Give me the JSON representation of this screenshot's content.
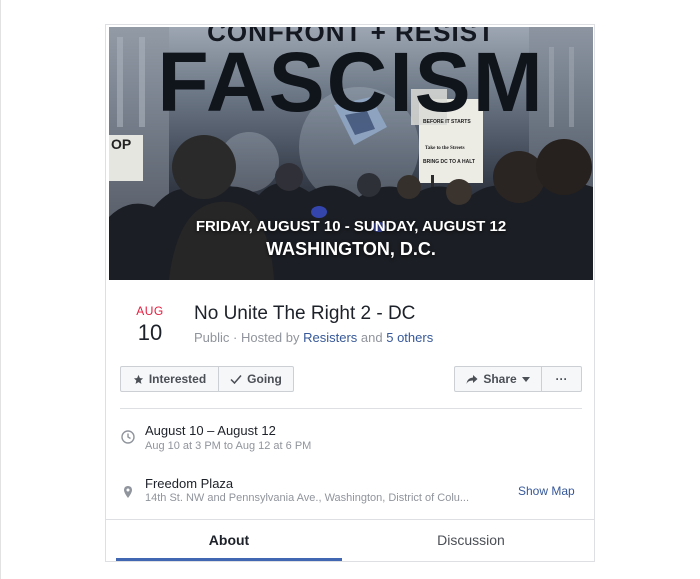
{
  "cover": {
    "headline_top": "CONFRONT + RESIST",
    "headline_main": "FASCISM",
    "dates": "FRIDAY, AUGUST 10 - SUNDAY, AUGUST 12",
    "city": "WASHINGTON, D.C.",
    "sign_left": "OP",
    "sign_right_line1": "BEFORE IT STARTS",
    "sign_right_line2": "Take to the Streets",
    "sign_right_line3": "BRING DC TO A HALT"
  },
  "event": {
    "month": "AUG",
    "day": "10",
    "title": "No Unite The Right 2 - DC",
    "privacy": "Public",
    "hosted_prefix": " · Hosted by ",
    "host": "Resisters",
    "and_text": " and ",
    "others": "5 others"
  },
  "actions": {
    "interested": "Interested",
    "going": "Going",
    "share": "Share",
    "more": "···"
  },
  "when": {
    "main": "August 10 – August 12",
    "sub": "Aug 10 at 3 PM to Aug 12 at 6 PM"
  },
  "where": {
    "main": "Freedom Plaza",
    "sub": "14th St. NW and Pennsylvania Ave., Washington, District of Colu...",
    "map_link": "Show Map"
  },
  "tabs": {
    "about": "About",
    "discussion": "Discussion"
  },
  "colors": {
    "accent": "#4267b2",
    "link": "#365899",
    "month": "#e41e3f",
    "muted": "#90949c"
  },
  "icons": [
    "star-icon",
    "check-icon",
    "share-arrow-icon",
    "caret-down-icon",
    "more-dots-icon",
    "clock-icon",
    "pin-icon"
  ]
}
